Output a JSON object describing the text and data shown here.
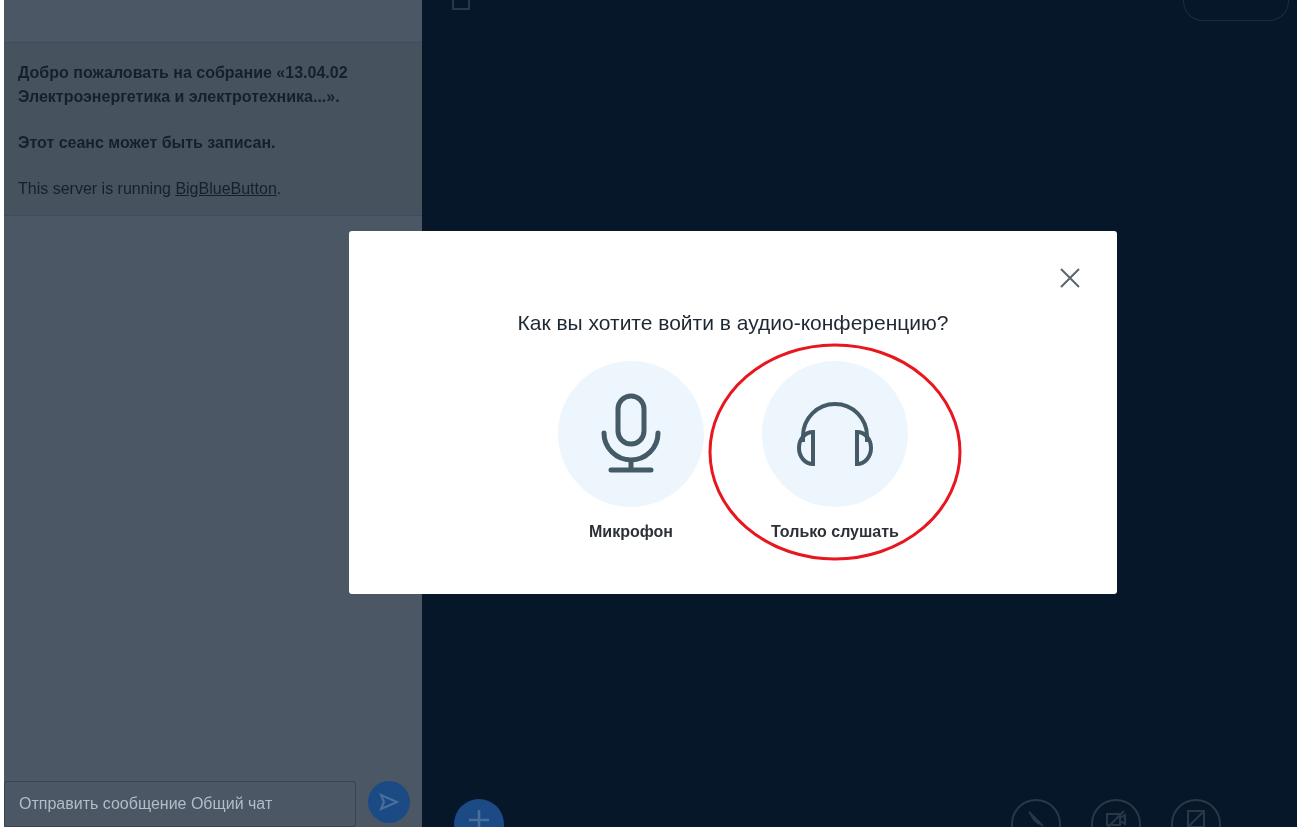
{
  "chat": {
    "messages": [
      {
        "kind": "bold",
        "text": "Добро пожаловать на собрание «13.04.02 Электроэнергетика и электротехника...»."
      },
      {
        "kind": "bold",
        "text": "Этот сеанс может быть записан."
      },
      {
        "kind": "link",
        "text": "This server is running ",
        "link": "BigBlueButton",
        "suffix": "."
      }
    ],
    "input": {
      "placeholder": "Отправить сообщение Общий чат"
    }
  },
  "modal": {
    "title": "Как вы хотите войти в аудио-конференцию?",
    "options": [
      {
        "kind": "microphone",
        "label": "Микрофон",
        "highlighted": false
      },
      {
        "kind": "listen",
        "label": "Только слушать",
        "highlighted": true
      }
    ]
  }
}
